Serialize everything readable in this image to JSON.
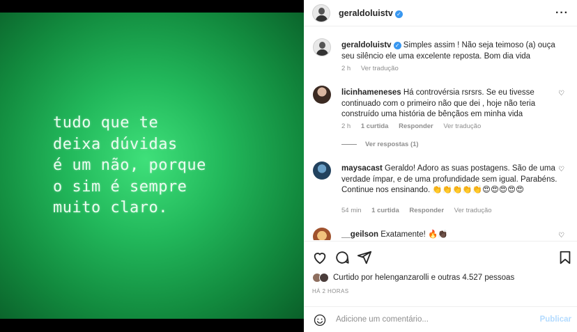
{
  "media": {
    "quote": "tudo que te\ndeixa dúvidas\né um não, porque\no sim é sempre\nmuito claro."
  },
  "header": {
    "username": "geraldoluistv",
    "more_icon": "ellipsis-icon"
  },
  "caption": {
    "username": "geraldoluistv",
    "text": " Simples assim ! Não seja teimoso (a) ouça seu silêncio ele uma excelente reposta. Bom dia vida",
    "time": "2 h",
    "translate": "Ver tradução"
  },
  "comments": [
    {
      "username": "licinhameneses",
      "text": " Há controvérsia rsrsrs. Se eu tivesse continuado com o primeiro não que dei , hoje não teria construído uma história de bênçãos em minha vida",
      "time": "2 h",
      "likes": "1 curtida",
      "reply": "Responder",
      "translate": "Ver tradução",
      "view_replies": "Ver respostas (1)"
    },
    {
      "username": "maysacast",
      "text": " Geraldo! Adoro as suas postagens. São de uma verdade ímpar, e de uma profundidade sem igual. Parabéns. Continue nos ensinando. 👏👏👏👏👏😍😍😍😍😍",
      "time": "54 min",
      "likes": "1 curtida",
      "reply": "Responder",
      "translate": "Ver tradução"
    },
    {
      "username": "__geilson",
      "text": " Exatamente! 🔥👏🏿"
    }
  ],
  "actions": {
    "like_icon": "heart-icon",
    "comment_icon": "comment-icon",
    "share_icon": "share-icon",
    "save_icon": "bookmark-icon"
  },
  "likes_text": "Curtido por helenganzarolli e outras 4.527 pessoas",
  "post_time": "HÁ 2 HORAS",
  "add_comment": {
    "placeholder": "Adicione um comentário...",
    "publish": "Publicar"
  },
  "colors": {
    "green_bright": "#3fe07a",
    "green_dark": "#0a5f29",
    "verified_blue": "#3897f0",
    "publish_disabled": "#b3dbff",
    "muted_text": "#8e8e8e"
  }
}
